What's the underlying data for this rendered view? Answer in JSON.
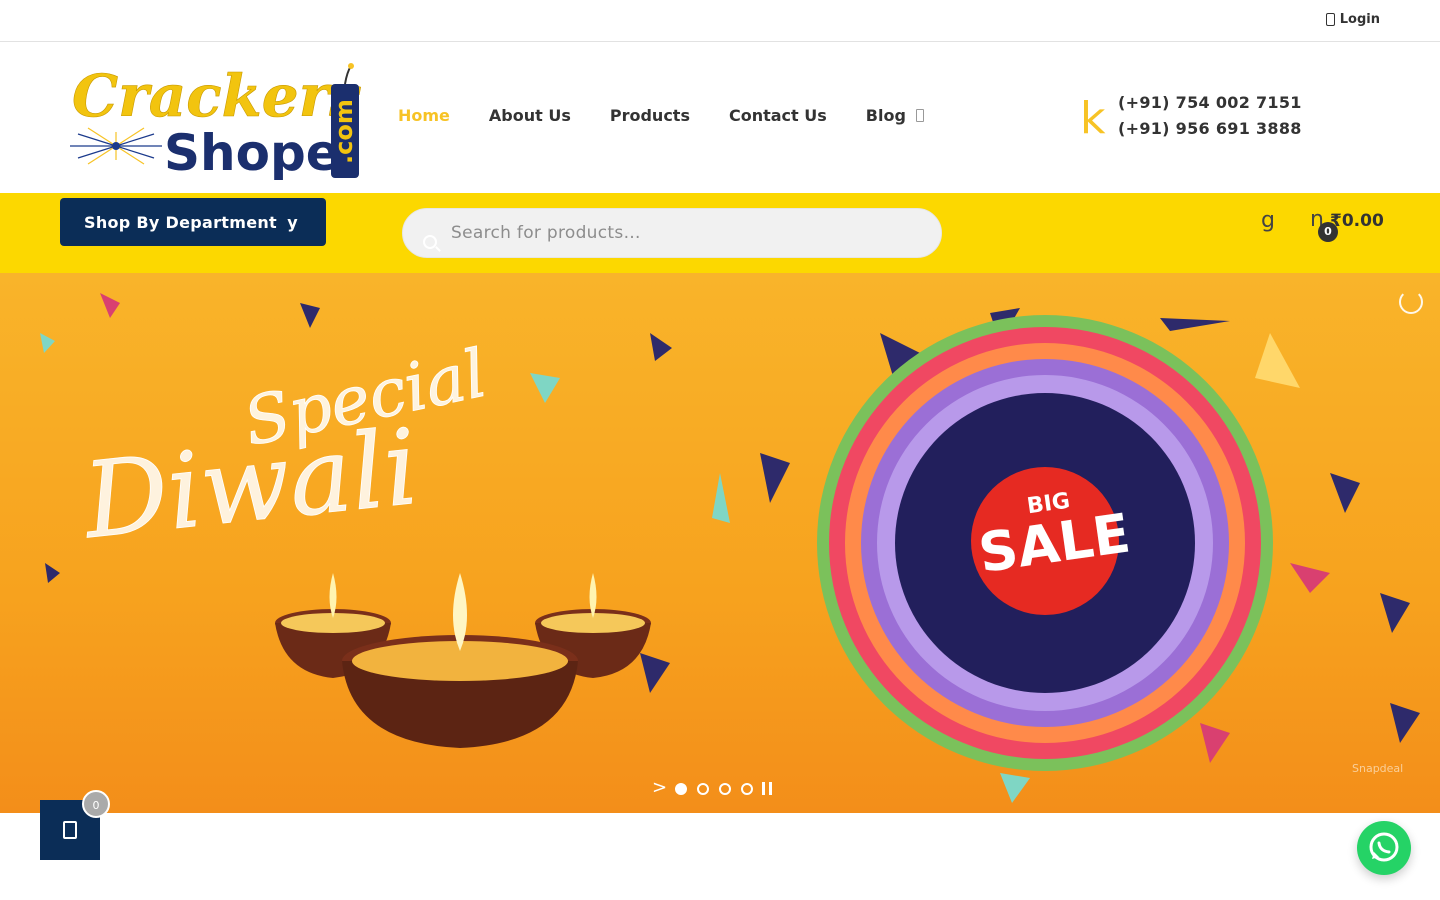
{
  "topbar": {
    "login_label": "Login",
    "login_icon": "user-icon"
  },
  "logo": {
    "line1": "Crackers",
    "line2": "Shope",
    "suffix": ".com"
  },
  "nav": {
    "items": [
      {
        "label": "Home",
        "active": true
      },
      {
        "label": "About Us"
      },
      {
        "label": "Products"
      },
      {
        "label": "Contact Us"
      },
      {
        "label": "Blog",
        "icon": "chevron-down-icon"
      }
    ]
  },
  "contact": {
    "icon_glyph": "k",
    "phone1": "(+91) 754 002 7151",
    "phone2": "(+91) 956 691 3888"
  },
  "department": {
    "label": "Shop By Department",
    "icon_glyph": "y"
  },
  "search": {
    "placeholder": "Search for products…",
    "icon": "search-icon"
  },
  "wishlist": {
    "icon_glyph": "g"
  },
  "cart": {
    "icon_glyph": "n",
    "total": "₹0.00",
    "count": "0"
  },
  "hero": {
    "script_line1": "Special",
    "script_line2": "Diwali",
    "badge_top": "BIG",
    "badge_main": "SALE",
    "watermark": "Snapdeal",
    "slider": {
      "slide_count": 5,
      "active_index": 0
    }
  },
  "floating_cart": {
    "count": "0",
    "icon": "shopping-bag-icon"
  },
  "whatsapp": {
    "icon": "whatsapp-icon"
  },
  "colors": {
    "brand_yellow": "#fcd800",
    "nav_active": "#f7c325",
    "navy": "#0b2d57",
    "hero_orange": "#f7a21e",
    "whatsapp_green": "#25d366"
  }
}
